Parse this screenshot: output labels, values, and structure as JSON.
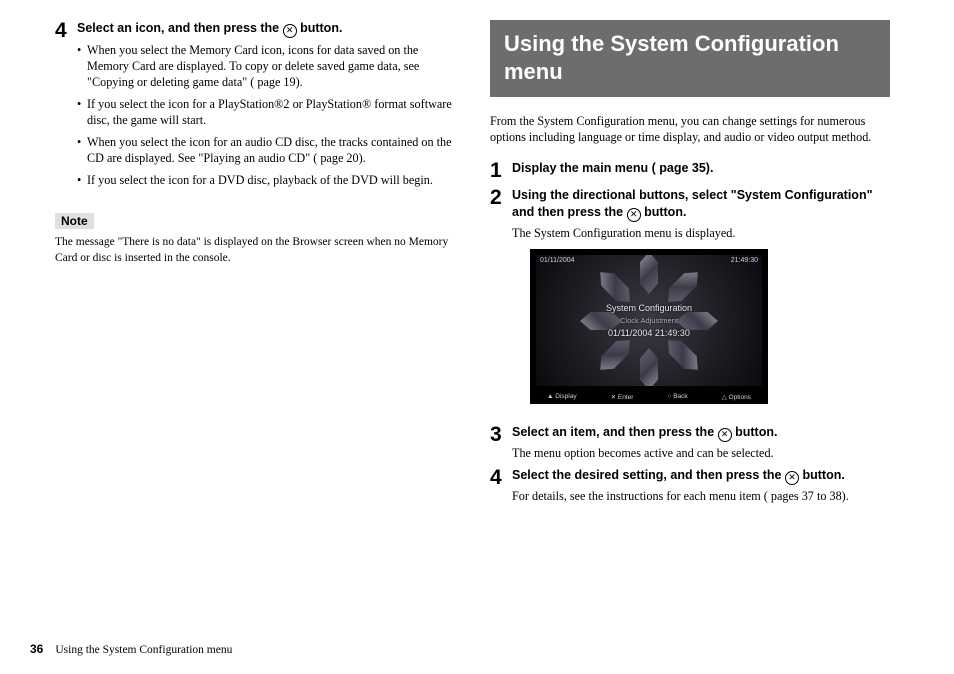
{
  "left": {
    "step4": {
      "num": "4",
      "title_a": "Select an icon, and then press the ",
      "title_b": " button.",
      "bullets": [
        "When you select the Memory Card icon, icons for data saved on the Memory Card are displayed. To copy or delete saved game data, see \"Copying or deleting game data\" ( page 19).",
        "If you select the icon for a PlayStation®2 or PlayStation® format software disc, the game will start.",
        "When you select the icon for an audio CD disc, the tracks contained on the CD are displayed. See \"Playing an audio CD\" ( page 20).",
        "If you select the icon for a DVD disc, playback of the DVD will begin."
      ]
    },
    "note_label": "Note",
    "note_text": "The message \"There is no data\" is displayed on the Browser screen when no Memory Card or disc is inserted in the console."
  },
  "right": {
    "section_title": "Using the System Configuration menu",
    "intro": "From the System Configuration menu, you can change settings for numerous options including language or time display, and audio or video output method.",
    "step1": {
      "num": "1",
      "title": "Display the main menu ( page 35)."
    },
    "step2": {
      "num": "2",
      "title_a": "Using the directional buttons, select \"System Configuration\" and then press the ",
      "title_b": " button.",
      "desc": "The System Configuration menu is displayed."
    },
    "screenshot": {
      "date": "01/11/2004",
      "time": "21:49:30",
      "title": "System Configuration",
      "item": "Clock Adjustment",
      "value": "01/11/2004 21:49:30",
      "hints": {
        "display": "Display",
        "enter": "Enter",
        "back": "Back",
        "options": "Options"
      }
    },
    "step3": {
      "num": "3",
      "title_a": "Select an item, and then press the ",
      "title_b": " button.",
      "desc": "The menu option becomes active and can be selected."
    },
    "step4": {
      "num": "4",
      "title_a": "Select the desired setting, and then press the ",
      "title_b": " button.",
      "desc": "For details, see the instructions for each menu item ( pages 37 to 38)."
    }
  },
  "footer": {
    "page": "36",
    "title": "Using the System Configuration menu"
  }
}
